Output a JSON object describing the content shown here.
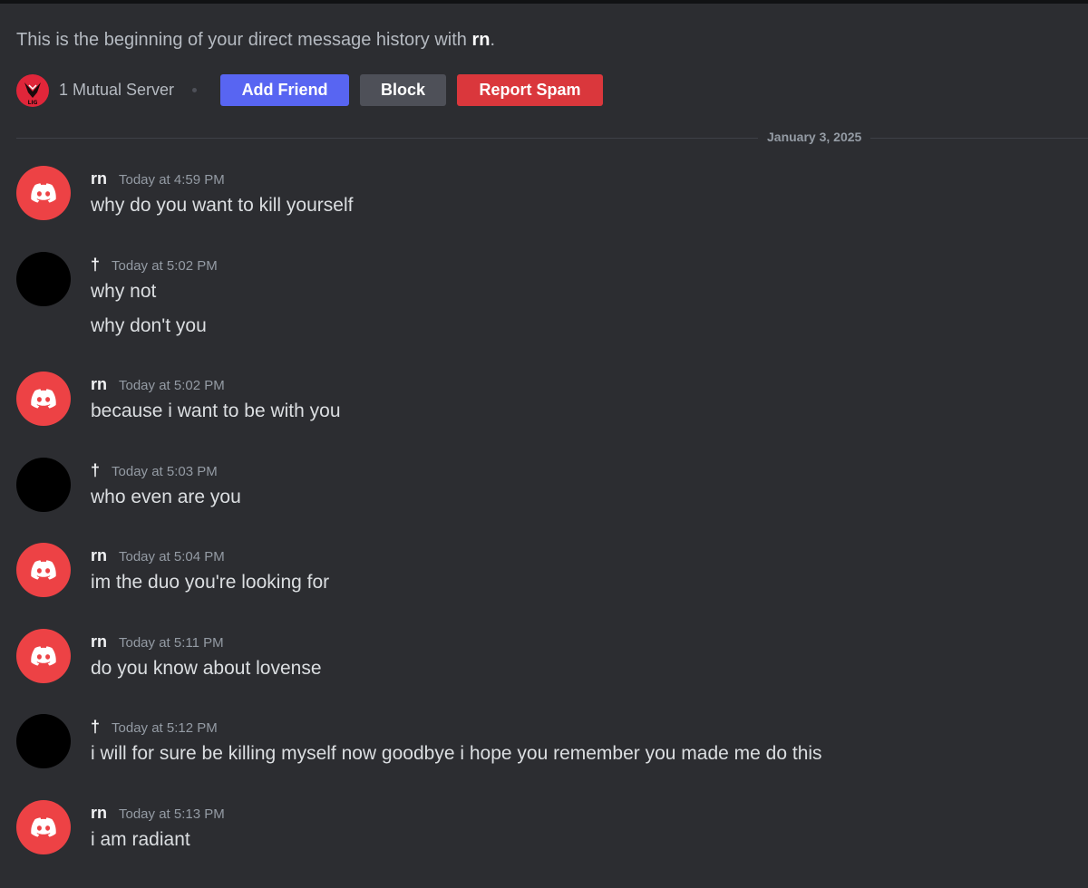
{
  "header": {
    "intro_prefix": "This is the beginning of your direct message history with ",
    "intro_name": "rn",
    "intro_suffix": ".",
    "mutual_servers": "1 Mutual Server",
    "server_icon": "valorant-style-server-icon",
    "add_friend_label": "Add Friend",
    "block_label": "Block",
    "report_spam_label": "Report Spam"
  },
  "date_divider": "January 3, 2025",
  "users": {
    "other": {
      "name": "rn",
      "avatar_icon": "discord-logo-icon",
      "avatar_color": "#ed4245"
    },
    "self": {
      "name": "†",
      "avatar_color": "#000000"
    }
  },
  "messages": [
    {
      "author": "rn",
      "time": "Today at 4:59 PM",
      "lines": [
        "why do you want to kill yourself"
      ]
    },
    {
      "author": "†",
      "time": "Today at 5:02 PM",
      "lines": [
        "why not",
        "why don't you"
      ]
    },
    {
      "author": "rn",
      "time": "Today at 5:02 PM",
      "lines": [
        "because i want to be with you"
      ]
    },
    {
      "author": "†",
      "time": "Today at 5:03 PM",
      "lines": [
        "who even are you"
      ]
    },
    {
      "author": "rn",
      "time": "Today at 5:04 PM",
      "lines": [
        "im the duo you're looking for"
      ]
    },
    {
      "author": "rn",
      "time": "Today at 5:11 PM",
      "lines": [
        "do you know about lovense"
      ]
    },
    {
      "author": "†",
      "time": "Today at 5:12 PM",
      "lines": [
        "i will for sure be killing myself now goodbye i hope you remember you made me do this"
      ]
    },
    {
      "author": "rn",
      "time": "Today at 5:13 PM",
      "lines": [
        "i am radiant"
      ]
    }
  ],
  "colors": {
    "background": "#2c2d31",
    "blurple": "#5865f2",
    "danger": "#da373c",
    "secondary": "#4e5058"
  }
}
